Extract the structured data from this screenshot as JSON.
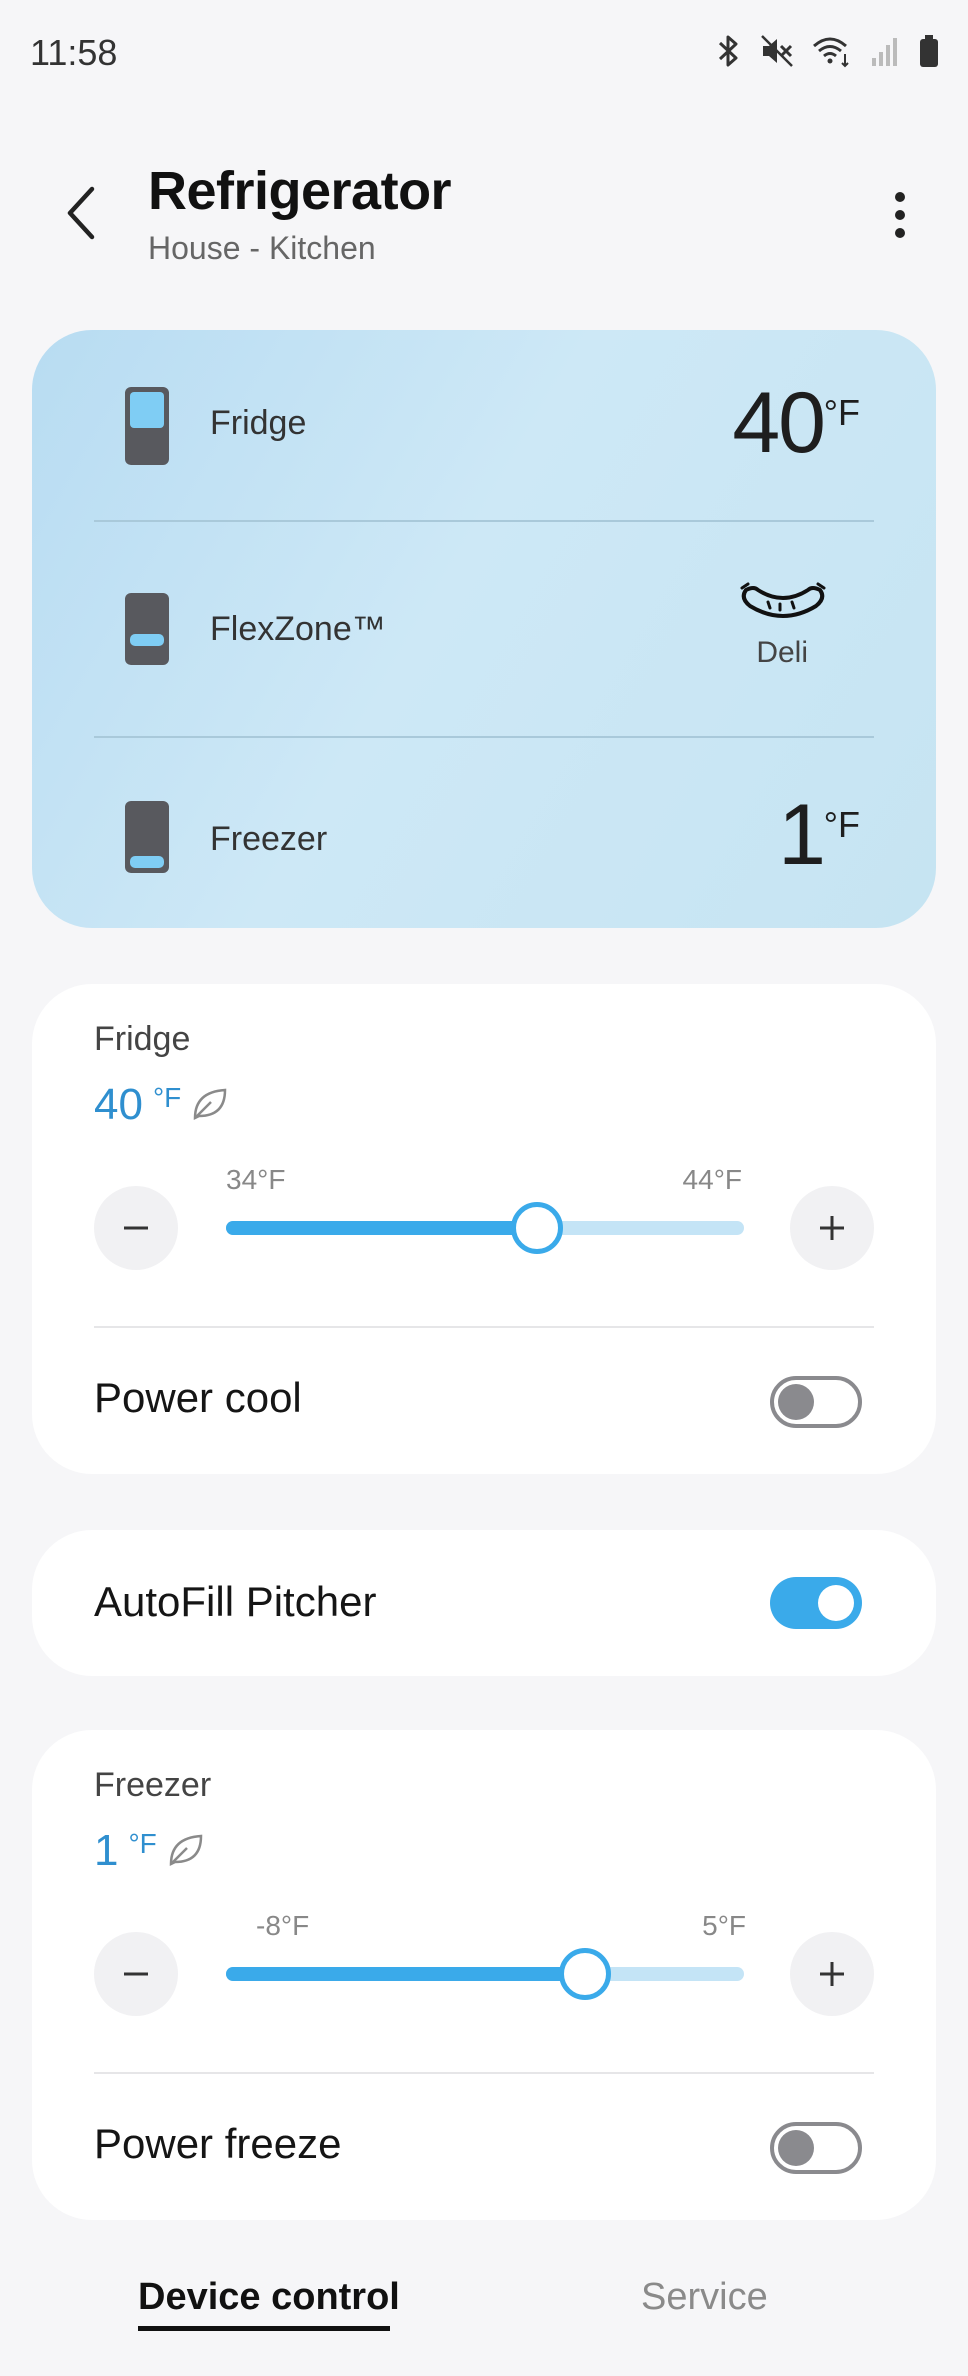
{
  "status_bar": {
    "time": "11:58",
    "icons": [
      "bluetooth-icon",
      "mute-icon",
      "wifi-icon",
      "signal-icon",
      "battery-icon"
    ]
  },
  "header": {
    "title": "Refrigerator",
    "subtitle": "House - Kitchen"
  },
  "summary": {
    "fridge": {
      "name": "Fridge",
      "temp": "40",
      "unit": "°F"
    },
    "flexzone": {
      "name": "FlexZone™",
      "mode": "Deli"
    },
    "freezer": {
      "name": "Freezer",
      "temp": "1",
      "unit": "°F"
    }
  },
  "fridge_control": {
    "label": "Fridge",
    "temp": "40",
    "unit": "°F",
    "min_label": "34°F",
    "max_label": "44°F",
    "min": 34,
    "max": 44,
    "value": 40,
    "power_label": "Power cool",
    "power_on": false
  },
  "autofill": {
    "label": "AutoFill Pitcher",
    "on": true
  },
  "freezer_control": {
    "label": "Freezer",
    "temp": "1",
    "unit": "°F",
    "min_label": "-8°F",
    "max_label": "5°F",
    "min": -8,
    "max": 5,
    "value": 1,
    "power_label": "Power freeze",
    "power_on": false
  },
  "tabs": {
    "device_control": "Device control",
    "service": "Service"
  },
  "colors": {
    "accent": "#3aaaea",
    "temp_text": "#2f8fcf",
    "track_light": "#c4e4f6"
  }
}
